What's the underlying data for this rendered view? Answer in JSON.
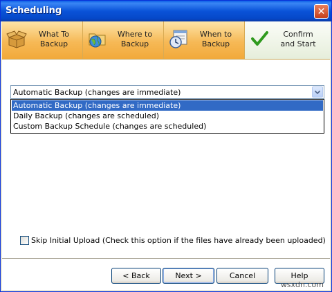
{
  "window": {
    "title": "Scheduling",
    "close_glyph": "✕"
  },
  "steps": [
    {
      "label": "What To\nBackup",
      "icon": "open-box-icon"
    },
    {
      "label": "Where to\nBackup",
      "icon": "folder-globe-icon"
    },
    {
      "label": "When to\nBackup",
      "icon": "calendar-clock-icon"
    },
    {
      "label": "Confirm\nand Start",
      "icon": "checkmark-icon"
    }
  ],
  "schedule": {
    "selected": "Automatic Backup (changes are immediate)",
    "options": [
      "Automatic Backup (changes are immediate)",
      "Daily Backup (changes are scheduled)",
      "Custom Backup Schedule (changes are scheduled)"
    ]
  },
  "skip_upload": {
    "label": "Skip Initial Upload (Check this option if the files have already been uploaded)",
    "checked": false
  },
  "buttons": {
    "back": "< Back",
    "next": "Next >",
    "cancel": "Cancel",
    "help": "Help"
  },
  "watermark": "wsxdn.com",
  "colors": {
    "title_blue": "#0a53d8",
    "step_orange": "#f6b956",
    "selection": "#316ac5"
  }
}
